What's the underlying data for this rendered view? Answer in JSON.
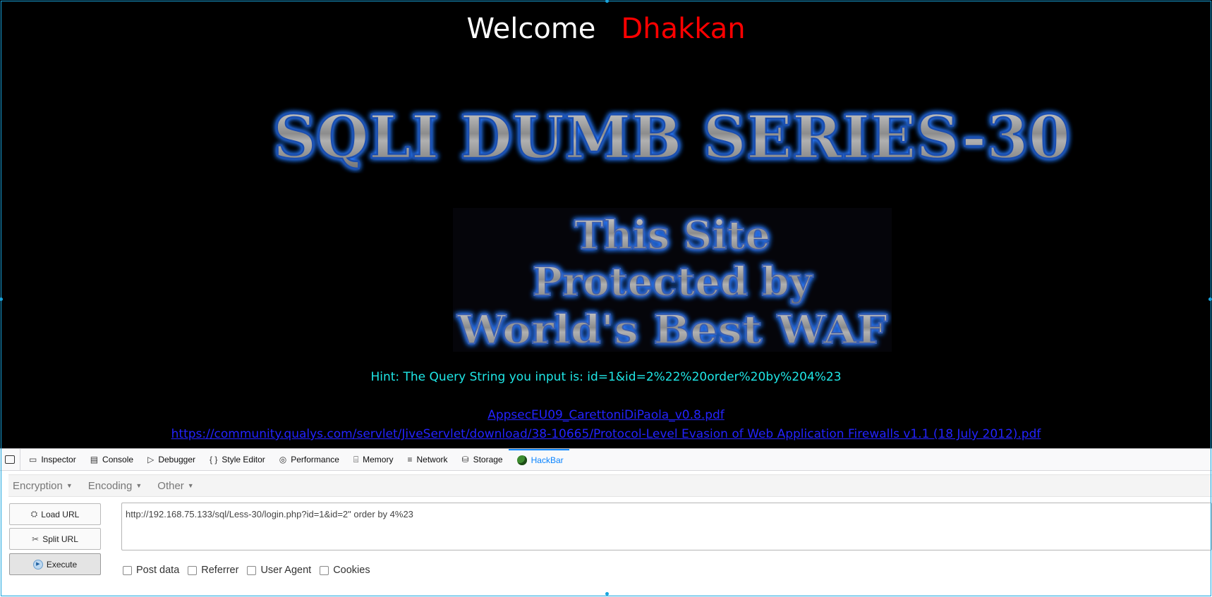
{
  "page": {
    "welcome_label": "Welcome",
    "welcome_name": "Dhakkan",
    "banner_title": "SQLI DUMB SERIES-30",
    "banner_waf_line1": "This Site",
    "banner_waf_line2": "Protected by",
    "banner_waf_line3": "World's Best WAF",
    "hint": "Hint: The Query String you input is: id=1&id=2%22%20order%20by%204%23",
    "link1": "AppsecEU09_CarettoniDiPaola_v0.8.pdf",
    "link2": "https://community.qualys.com/servlet/JiveServlet/download/38-10665/Protocol-Level Evasion of Web Application Firewalls v1.1 (18 July 2012).pdf",
    "colors": {
      "welcome": "#ffffff",
      "name": "#ff0000",
      "hint": "#1fe6e6",
      "link": "#2323ff"
    }
  },
  "devtools": {
    "tabs": [
      {
        "label": "Inspector",
        "icon": "inspector-icon"
      },
      {
        "label": "Console",
        "icon": "console-icon"
      },
      {
        "label": "Debugger",
        "icon": "debugger-icon"
      },
      {
        "label": "Style Editor",
        "icon": "style-editor-icon"
      },
      {
        "label": "Performance",
        "icon": "performance-icon"
      },
      {
        "label": "Memory",
        "icon": "memory-icon"
      },
      {
        "label": "Network",
        "icon": "network-icon"
      },
      {
        "label": "Storage",
        "icon": "storage-icon"
      },
      {
        "label": "HackBar",
        "icon": "hackbar-icon",
        "active": true
      }
    ]
  },
  "hackbar": {
    "menus": [
      "Encryption",
      "Encoding",
      "Other"
    ],
    "load_url": "Load URL",
    "split_url": "Split URL",
    "execute": "Execute",
    "url_value": "http://192.168.75.133/sql/Less-30/login.php?id=1&id=2\" order by 4%23",
    "options": [
      "Post data",
      "Referrer",
      "User Agent",
      "Cookies"
    ]
  }
}
